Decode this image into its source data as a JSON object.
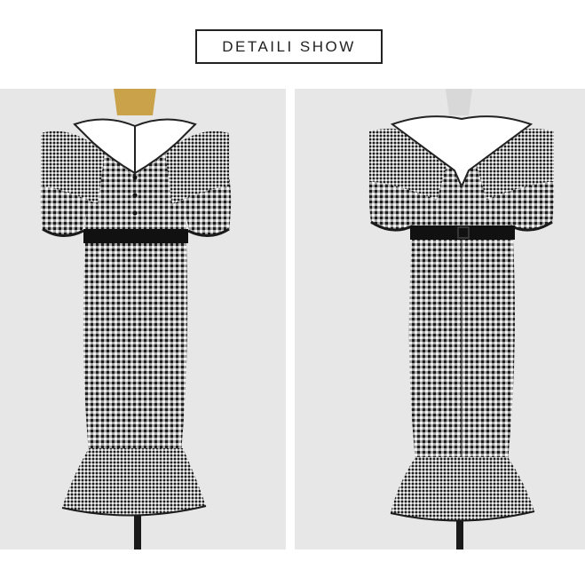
{
  "header": {
    "title": "DETAILI SHOW"
  },
  "colors": {
    "background": "#ffffff",
    "panel": "#e7e7e7",
    "fabric_dark": "#2b2b2b",
    "fabric_light": "#f4f4f4",
    "collar": "#ffffff",
    "belt": "#111111"
  },
  "images": [
    {
      "name": "dress-front-photo",
      "view": "front"
    },
    {
      "name": "dress-back-photo",
      "view": "back"
    }
  ]
}
